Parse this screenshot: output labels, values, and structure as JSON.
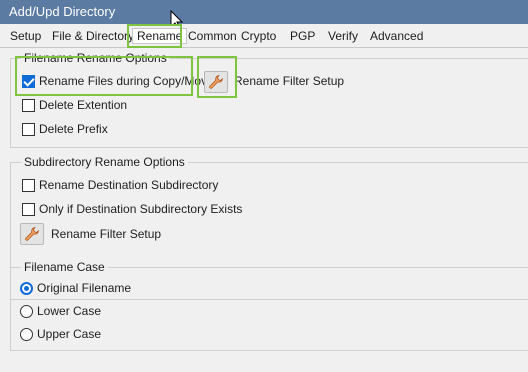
{
  "window": {
    "title": "Add/Upd Directory"
  },
  "tabs": [
    {
      "label": "Setup"
    },
    {
      "label": "File & Directory"
    },
    {
      "label": "Rename"
    },
    {
      "label": "Common"
    },
    {
      "label": "Crypto"
    },
    {
      "label": "PGP"
    },
    {
      "label": "Verify"
    },
    {
      "label": "Advanced"
    }
  ],
  "active_tab": "Rename",
  "filename_rename": {
    "title": "Filename Rename Options",
    "rename_files": {
      "label": "Rename Files during Copy/Move",
      "checked": true
    },
    "filter_setup_label": "Rename Filter Setup",
    "delete_extension": {
      "label": "Delete Extention",
      "checked": false
    },
    "delete_prefix": {
      "label": "Delete Prefix",
      "checked": false
    }
  },
  "subdirectory_rename": {
    "title": "Subdirectory Rename Options",
    "rename_dest": {
      "label": "Rename Destination Subdirectory",
      "checked": false
    },
    "only_if_exists": {
      "label": "Only if Destination Subdirectory Exists",
      "checked": false
    },
    "filter_setup_label": "Rename Filter Setup"
  },
  "filename_case": {
    "title": "Filename Case",
    "options": [
      {
        "label": "Original Filename",
        "selected": true
      },
      {
        "label": "Lower Case",
        "selected": false
      },
      {
        "label": "Upper Case",
        "selected": false
      }
    ]
  },
  "colors": {
    "titlebar": "#5b7ba3",
    "highlight": "#7ec440",
    "accent": "#0f6bd6"
  },
  "icons": {
    "filter_button": "wrench-icon",
    "cursor": "mouse-cursor-icon"
  }
}
